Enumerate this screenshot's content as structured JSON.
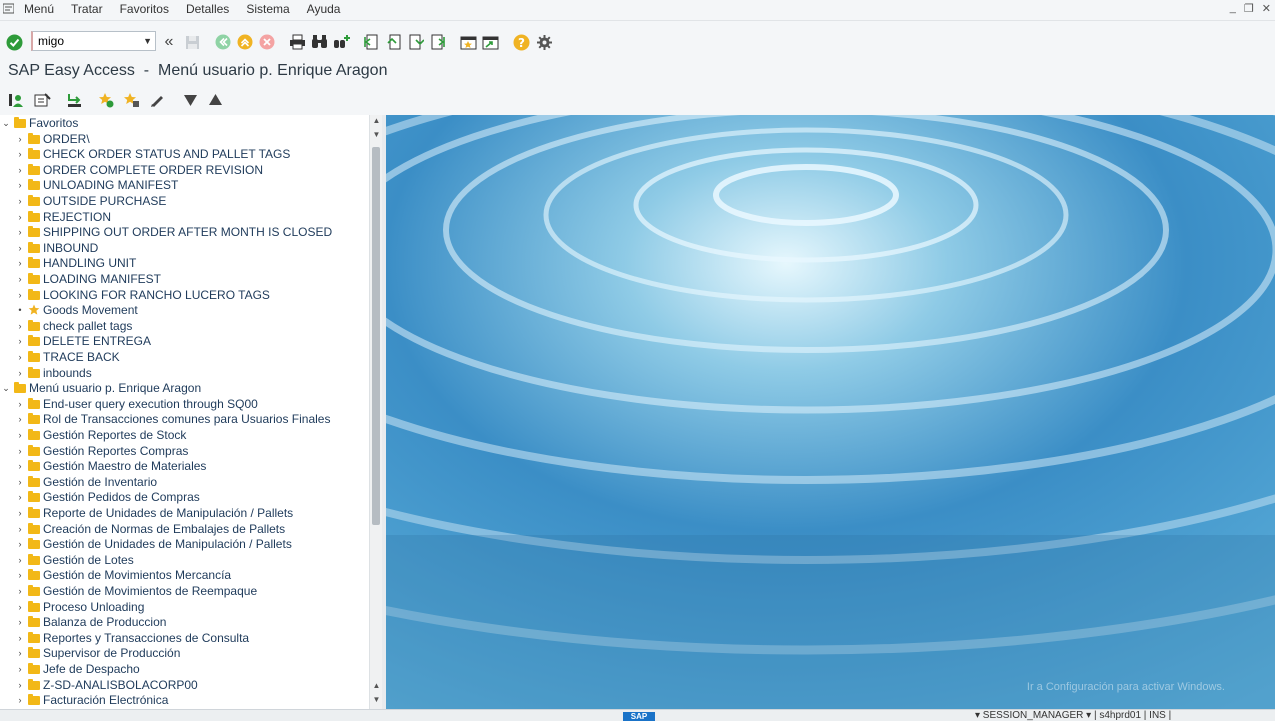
{
  "menubar": {
    "items": [
      "Menú",
      "Tratar",
      "Favoritos",
      "Detalles",
      "Sistema",
      "Ayuda"
    ],
    "window_controls": [
      "_",
      "❐",
      "✕"
    ]
  },
  "toolbar": {
    "command_value": "migo"
  },
  "title": "SAP Easy Access  -  Menú usuario p. Enrique Aragon",
  "tree": {
    "favorites_root": "Favoritos",
    "favorites": [
      {
        "label": "ORDER\\",
        "icon": "folder-icon"
      },
      {
        "label": "CHECK ORDER STATUS AND PALLET TAGS",
        "icon": "folder-icon"
      },
      {
        "label": "ORDER COMPLETE ORDER REVISION",
        "icon": "folder-icon"
      },
      {
        "label": "UNLOADING MANIFEST",
        "icon": "folder-icon"
      },
      {
        "label": "OUTSIDE PURCHASE",
        "icon": "folder-icon"
      },
      {
        "label": "REJECTION",
        "icon": "folder-icon"
      },
      {
        "label": "SHIPPING OUT ORDER AFTER MONTH IS CLOSED",
        "icon": "folder-icon"
      },
      {
        "label": "INBOUND",
        "icon": "folder-icon"
      },
      {
        "label": "HANDLING UNIT",
        "icon": "folder-icon"
      },
      {
        "label": "LOADING MANIFEST",
        "icon": "folder-icon"
      },
      {
        "label": "LOOKING FOR RANCHO LUCERO TAGS",
        "icon": "folder-icon"
      },
      {
        "label": "Goods Movement",
        "icon": "star-icon"
      },
      {
        "label": "check pallet tags",
        "icon": "folder-icon"
      },
      {
        "label": "DELETE ENTREGA",
        "icon": "folder-icon"
      },
      {
        "label": "TRACE BACK",
        "icon": "folder-icon"
      },
      {
        "label": "inbounds",
        "icon": "folder-icon"
      }
    ],
    "user_menu_root": "Menú usuario p. Enrique Aragon",
    "user_menu": [
      "End-user query execution through SQ00",
      "Rol de Transacciones comunes para Usuarios Finales",
      "Gestión Reportes de Stock",
      "Gestión Reportes Compras",
      "Gestión  Maestro de Materiales",
      "Gestión de Inventario",
      "Gestión Pedidos de Compras",
      "Reporte de Unidades de Manipulación / Pallets",
      "Creación de Normas de Embalajes de Pallets",
      "Gestión de Unidades de Manipulación / Pallets",
      "Gestión de Lotes",
      "Gestión de Movimientos Mercancía",
      "Gestión de Movimientos de Reempaque",
      "Proceso Unloading",
      "Balanza de Produccion",
      "Reportes y Transacciones de Consulta",
      "Supervisor de Producción",
      "Jefe de Despacho",
      "Z-SD-ANALISBOLACORP00",
      "Facturación Electrónica"
    ]
  },
  "statusbar": {
    "logo": "SAP",
    "info": "▾  SESSION_MANAGER ▾  |  s4hprd01  |  INS  |"
  },
  "watermark": "Ir a Configuración para activar Windows."
}
